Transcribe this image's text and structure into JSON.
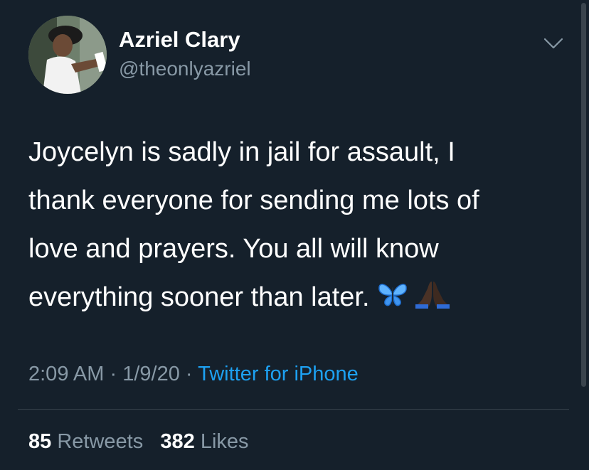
{
  "author": {
    "display_name": "Azriel Clary",
    "handle": "@theonlyazriel",
    "avatar_icon": "profile-photo",
    "menu_icon": "chevron-down-icon"
  },
  "tweet": {
    "lines": [
      "Joycelyn is sadly in jail for assault, I",
      "thank everyone for sending me lots of",
      "love and prayers. You all will know",
      "everything sooner than later."
    ],
    "emojis": [
      "butterfly-icon",
      "praying-hands-icon"
    ]
  },
  "meta": {
    "time": "2:09 AM",
    "sep1": "·",
    "date": "1/9/20",
    "sep2": "·",
    "source": "Twitter for iPhone"
  },
  "stats": {
    "retweets_count": "85",
    "retweets_label": "Retweets",
    "likes_count": "382",
    "likes_label": "Likes"
  },
  "colors": {
    "background": "#15202b",
    "primary_text": "#ffffff",
    "secondary_text": "#8899a6",
    "link": "#1da1f2",
    "divider": "#38444d"
  }
}
